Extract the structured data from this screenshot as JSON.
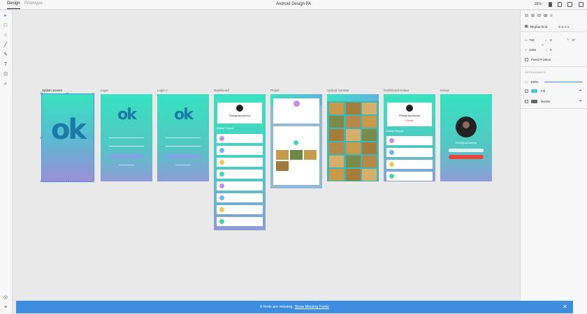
{
  "topbar": {
    "tabs": [
      "Design",
      "Prototype"
    ],
    "title": "Android Design PA",
    "zoom": "25%"
  },
  "artboards": [
    {
      "name": "Splash Screen"
    },
    {
      "name": "Login"
    },
    {
      "name": "Login 2"
    },
    {
      "name": "Dashboard"
    },
    {
      "name": "Projek"
    },
    {
      "name": "Upload Gambar"
    },
    {
      "name": "Dashboard Keluar"
    },
    {
      "name": "Keluar"
    }
  ],
  "logo_text": "ok",
  "profile_name": "Rizkaji Apriandra",
  "keluar_label": "Keluar",
  "dashboard_section": "Daftar Proyek",
  "properties": {
    "repeat_grid": "Repeat Grid",
    "w_label": "W",
    "w_value": "720",
    "h_label": "H",
    "h_value": "1280",
    "x_label": "X",
    "x_value": "0",
    "y_label": "Y",
    "y_value": "0",
    "rotation": "0°",
    "fixed_position": "Fixed Position",
    "appearance": "APPEARANCE",
    "opacity": "100%",
    "fill": "Fill",
    "border": "Border",
    "fill_color": "#47c9d6",
    "border_color": "#666666"
  },
  "banner": {
    "message": "6 fonts are missing.",
    "link": "Show Missing Fonts"
  },
  "colors": {
    "accent": "#3c8de0",
    "selection": "#4a90e2",
    "gradient_top": "#36e3c0",
    "gradient_bottom": "#8f9bd8",
    "danger": "#e8453c"
  }
}
